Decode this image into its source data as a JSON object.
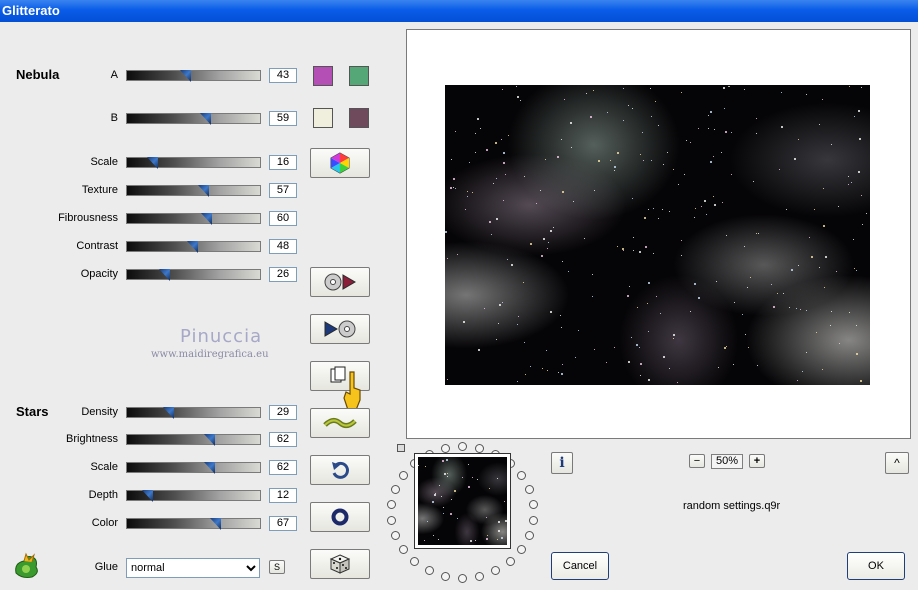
{
  "window": {
    "title": "Glitterato"
  },
  "nebula": {
    "section_label": "Nebula",
    "a_label": "A",
    "a_value": "43",
    "a_frac": 0.43,
    "b_label": "B",
    "b_value": "59",
    "b_frac": 0.59,
    "swatch_a1": "#b34fb5",
    "swatch_a2": "#56a778",
    "swatch_b1": "#f0eedc",
    "swatch_b2": "#6e4a5c"
  },
  "params": [
    {
      "label": "Scale",
      "value": "16",
      "frac": 0.16
    },
    {
      "label": "Texture",
      "value": "57",
      "frac": 0.57
    },
    {
      "label": "Fibrousness",
      "value": "60",
      "frac": 0.6
    },
    {
      "label": "Contrast",
      "value": "48",
      "frac": 0.48
    },
    {
      "label": "Opacity",
      "value": "26",
      "frac": 0.26
    }
  ],
  "stars": {
    "section_label": "Stars",
    "rows": [
      {
        "label": "Density",
        "value": "29",
        "frac": 0.29
      },
      {
        "label": "Brightness",
        "value": "62",
        "frac": 0.62
      },
      {
        "label": "Scale",
        "value": "62",
        "frac": 0.62
      },
      {
        "label": "Depth",
        "value": "12",
        "frac": 0.12
      },
      {
        "label": "Color",
        "value": "67",
        "frac": 0.67
      }
    ]
  },
  "watermark": {
    "name": "Pinuccia",
    "site": "www.maidiregrafica.eu"
  },
  "glue": {
    "label": "Glue",
    "value": "normal",
    "s_label": "S"
  },
  "zoom": {
    "minus": "−",
    "value": "50%",
    "plus": "+"
  },
  "preset_name": "random settings.q9r",
  "info_label": "i",
  "collapse_label": "^",
  "buttons": {
    "cancel": "Cancel",
    "ok": "OK"
  }
}
